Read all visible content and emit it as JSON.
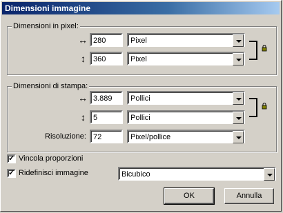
{
  "window": {
    "title": "Dimensioni immagine"
  },
  "pixel_group": {
    "label": "Dimensioni in pixel:",
    "width": {
      "value": "280",
      "unit": "Pixel",
      "icon": "horizontal-arrows-icon"
    },
    "height": {
      "value": "360",
      "unit": "Pixel",
      "icon": "vertical-arrows-icon"
    }
  },
  "print_group": {
    "label": "Dimensioni di stampa:",
    "width": {
      "value": "3.889",
      "unit": "Pollici",
      "icon": "horizontal-arrows-icon"
    },
    "height": {
      "value": "5",
      "unit": "Pollici",
      "icon": "vertical-arrows-icon"
    },
    "resolution": {
      "label": "Risoluzione:",
      "value": "72",
      "unit": "Pixel/pollice"
    }
  },
  "options": {
    "constrain": {
      "label": "Vincola proporzioni",
      "checked": true
    },
    "resample": {
      "label": "Ridefinisci immagine",
      "checked": true,
      "method": "Bicubico"
    }
  },
  "buttons": {
    "ok": "OK",
    "cancel": "Annulla"
  }
}
